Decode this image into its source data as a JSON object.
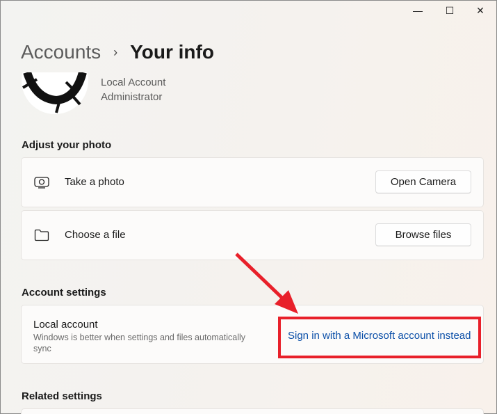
{
  "window": {
    "minimize": "—",
    "maximize": "☐",
    "close": "✕"
  },
  "breadcrumb": {
    "parent": "Accounts",
    "separator": "›",
    "current": "Your info"
  },
  "account": {
    "type": "Local Account",
    "role": "Administrator"
  },
  "adjust_photo": {
    "heading": "Adjust your photo",
    "items": [
      {
        "label": "Take a photo",
        "icon": "camera-icon",
        "button": "Open Camera"
      },
      {
        "label": "Choose a file",
        "icon": "folder-icon",
        "button": "Browse files"
      }
    ]
  },
  "account_settings": {
    "heading": "Account settings",
    "title": "Local account",
    "description": "Windows is better when settings and files automatically sync",
    "link": "Sign in with a Microsoft account instead"
  },
  "related": {
    "heading": "Related settings"
  },
  "annotation": {
    "color": "#e8202a"
  }
}
